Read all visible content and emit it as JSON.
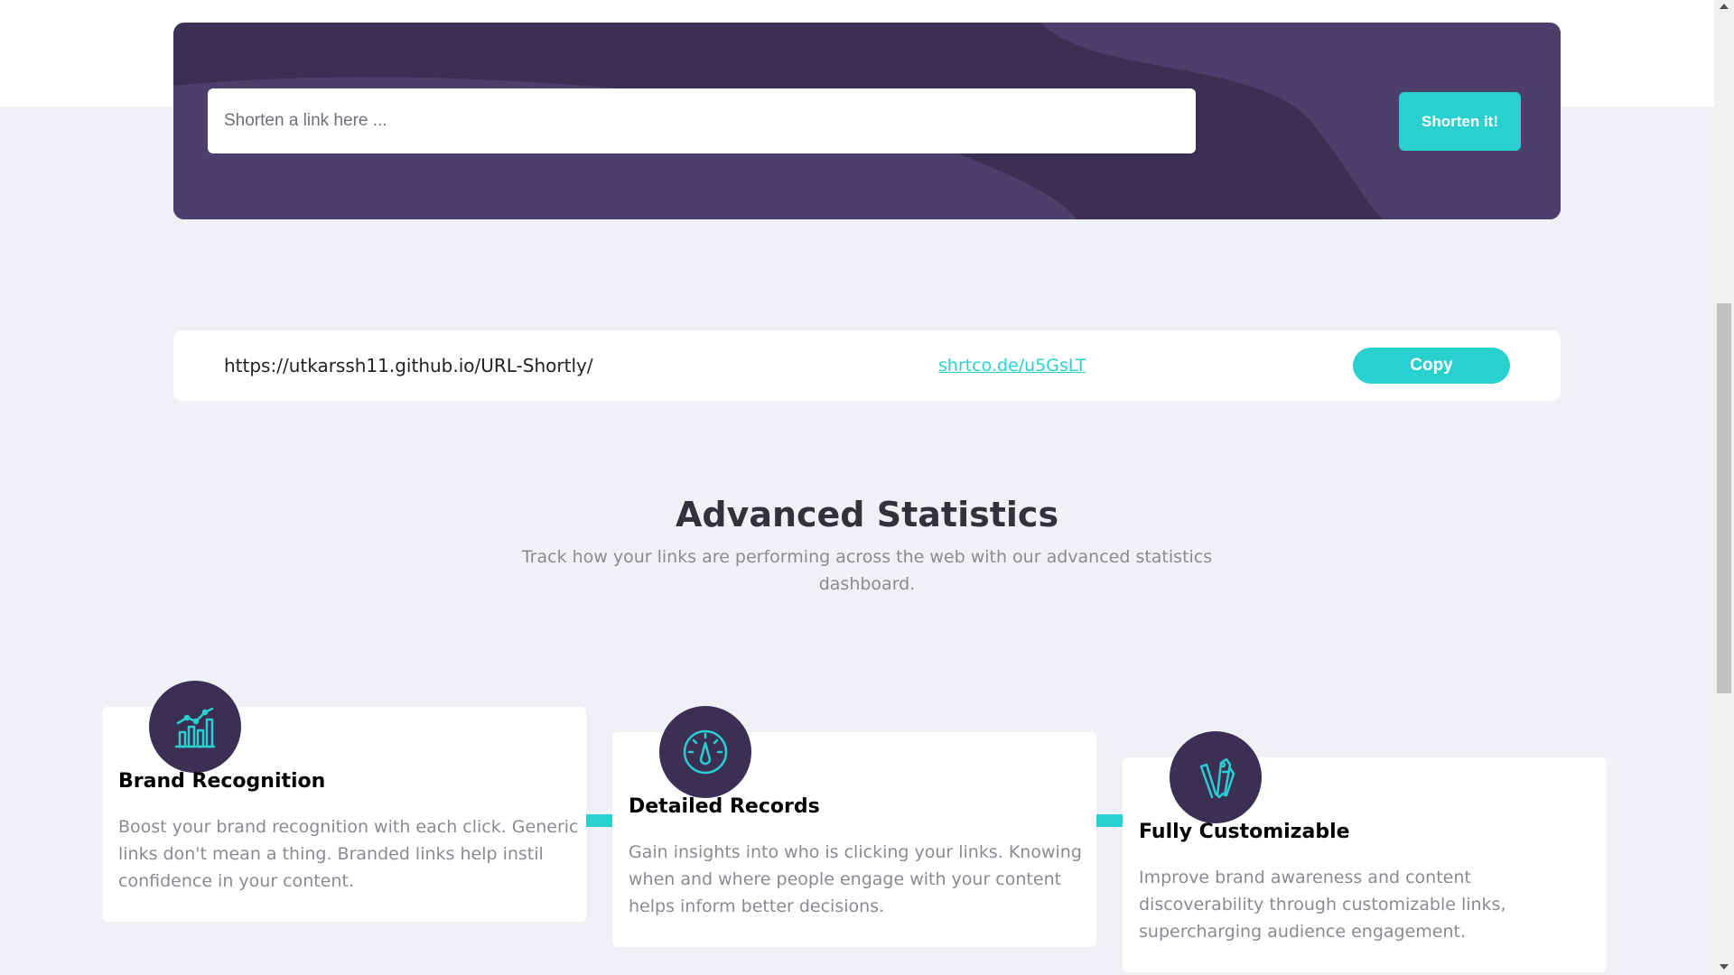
{
  "shorten": {
    "placeholder": "Shorten a link here ...",
    "button_label": "Shorten it!"
  },
  "result": {
    "original_url": "https://utkarssh11.github.io/URL-Shortly/",
    "short_url": "shrtco.de/u5GsLT",
    "copy_label": "Copy"
  },
  "stats": {
    "title": "Advanced Statistics",
    "subtitle": "Track how your links are performing across the web with our advanced statistics dashboard."
  },
  "features": [
    {
      "icon": "chart-icon",
      "title": "Brand Recognition",
      "text": "Boost your brand recognition with each click. Generic links don't mean a thing. Branded links help instil confidence in your content."
    },
    {
      "icon": "gauge-icon",
      "title": "Detailed Records",
      "text": "Gain insights into who is clicking your links. Knowing when and where people engage with your content helps inform better decisions."
    },
    {
      "icon": "pens-icon",
      "title": "Fully Customizable",
      "text": "Improve brand awareness and content discoverability through customizable links, supercharging audience engagement."
    }
  ],
  "colors": {
    "accent": "#2acfcf",
    "dark_violet": "#3b3054",
    "background": "#f0f1f6"
  }
}
